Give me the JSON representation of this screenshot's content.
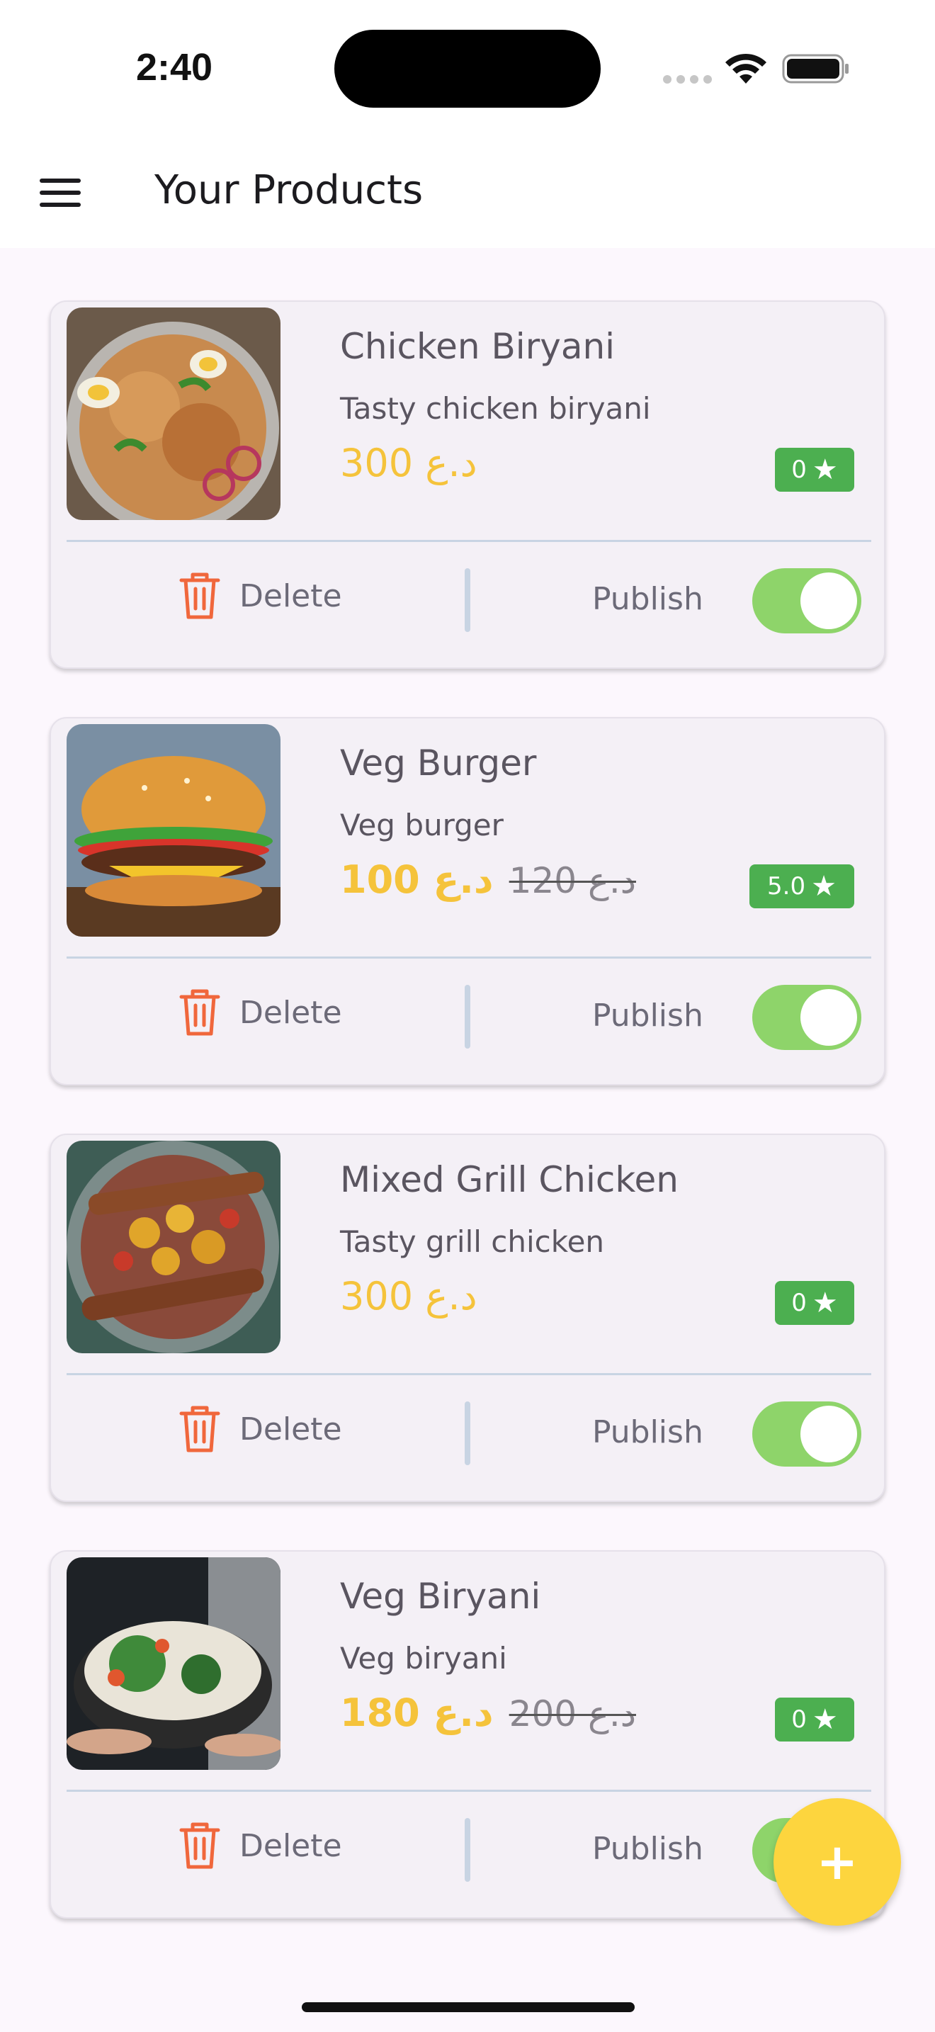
{
  "status": {
    "time": "2:40"
  },
  "app_bar": {
    "title": "Your Products"
  },
  "products": [
    {
      "name": "Chicken Biryani",
      "description": "Tasty chicken biryani",
      "price": "300 د.ع",
      "old_price": "",
      "rating": "0",
      "delete_label": "Delete",
      "publish_label": "Publish",
      "published": true
    },
    {
      "name": "Veg Burger",
      "description": "Veg burger",
      "price": "100 د.ع",
      "old_price": "120 د.ع",
      "rating": "5.0",
      "delete_label": "Delete",
      "publish_label": "Publish",
      "published": true
    },
    {
      "name": "Mixed Grill Chicken",
      "description": "Tasty grill chicken",
      "price": "300 د.ع",
      "old_price": "",
      "rating": "0",
      "delete_label": "Delete",
      "publish_label": "Publish",
      "published": true
    },
    {
      "name": "Veg Biryani",
      "description": "Veg biryani",
      "price": "180 د.ع",
      "old_price": "200 د.ع",
      "rating": "0",
      "delete_label": "Delete",
      "publish_label": "Publish",
      "published": true
    }
  ],
  "fab": {
    "icon": "plus-icon",
    "label": "+"
  },
  "colors": {
    "price": "#f5c33b",
    "rating_badge": "#4caf50",
    "toggle_on": "#8ed46a",
    "delete_icon": "#f0673c",
    "fab": "#fdd53e"
  }
}
